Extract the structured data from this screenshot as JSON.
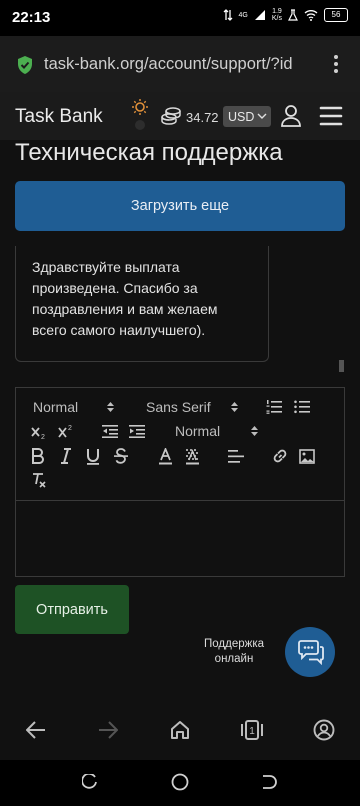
{
  "status_bar": {
    "time": "22:13",
    "network": "4G",
    "speed_value": "1.9",
    "speed_unit": "K/s",
    "battery": "56"
  },
  "browser": {
    "url": "task-bank.org/account/support/?id",
    "secure_icon": "shield-check-icon",
    "more_icon": "more-vert-icon"
  },
  "header": {
    "logo": "Task Bank",
    "balance": "34.72",
    "currency": "USD"
  },
  "page": {
    "title": "Техническая поддержка",
    "load_more": "Загрузить еще",
    "message": "Здравствуйте выплата произведена. Спасибо за поздравления и вам желаем всего самого наилучшего)."
  },
  "editor": {
    "header_select": "Normal",
    "font_select": "Sans Serif",
    "size_select": "Normal",
    "value": ""
  },
  "actions": {
    "submit": "Отправить",
    "support_line1": "Поддержка",
    "support_line2": "онлайн"
  },
  "colors": {
    "primary_blue": "#1f5d94",
    "submit_green": "#1e5225",
    "background": "#111111"
  }
}
